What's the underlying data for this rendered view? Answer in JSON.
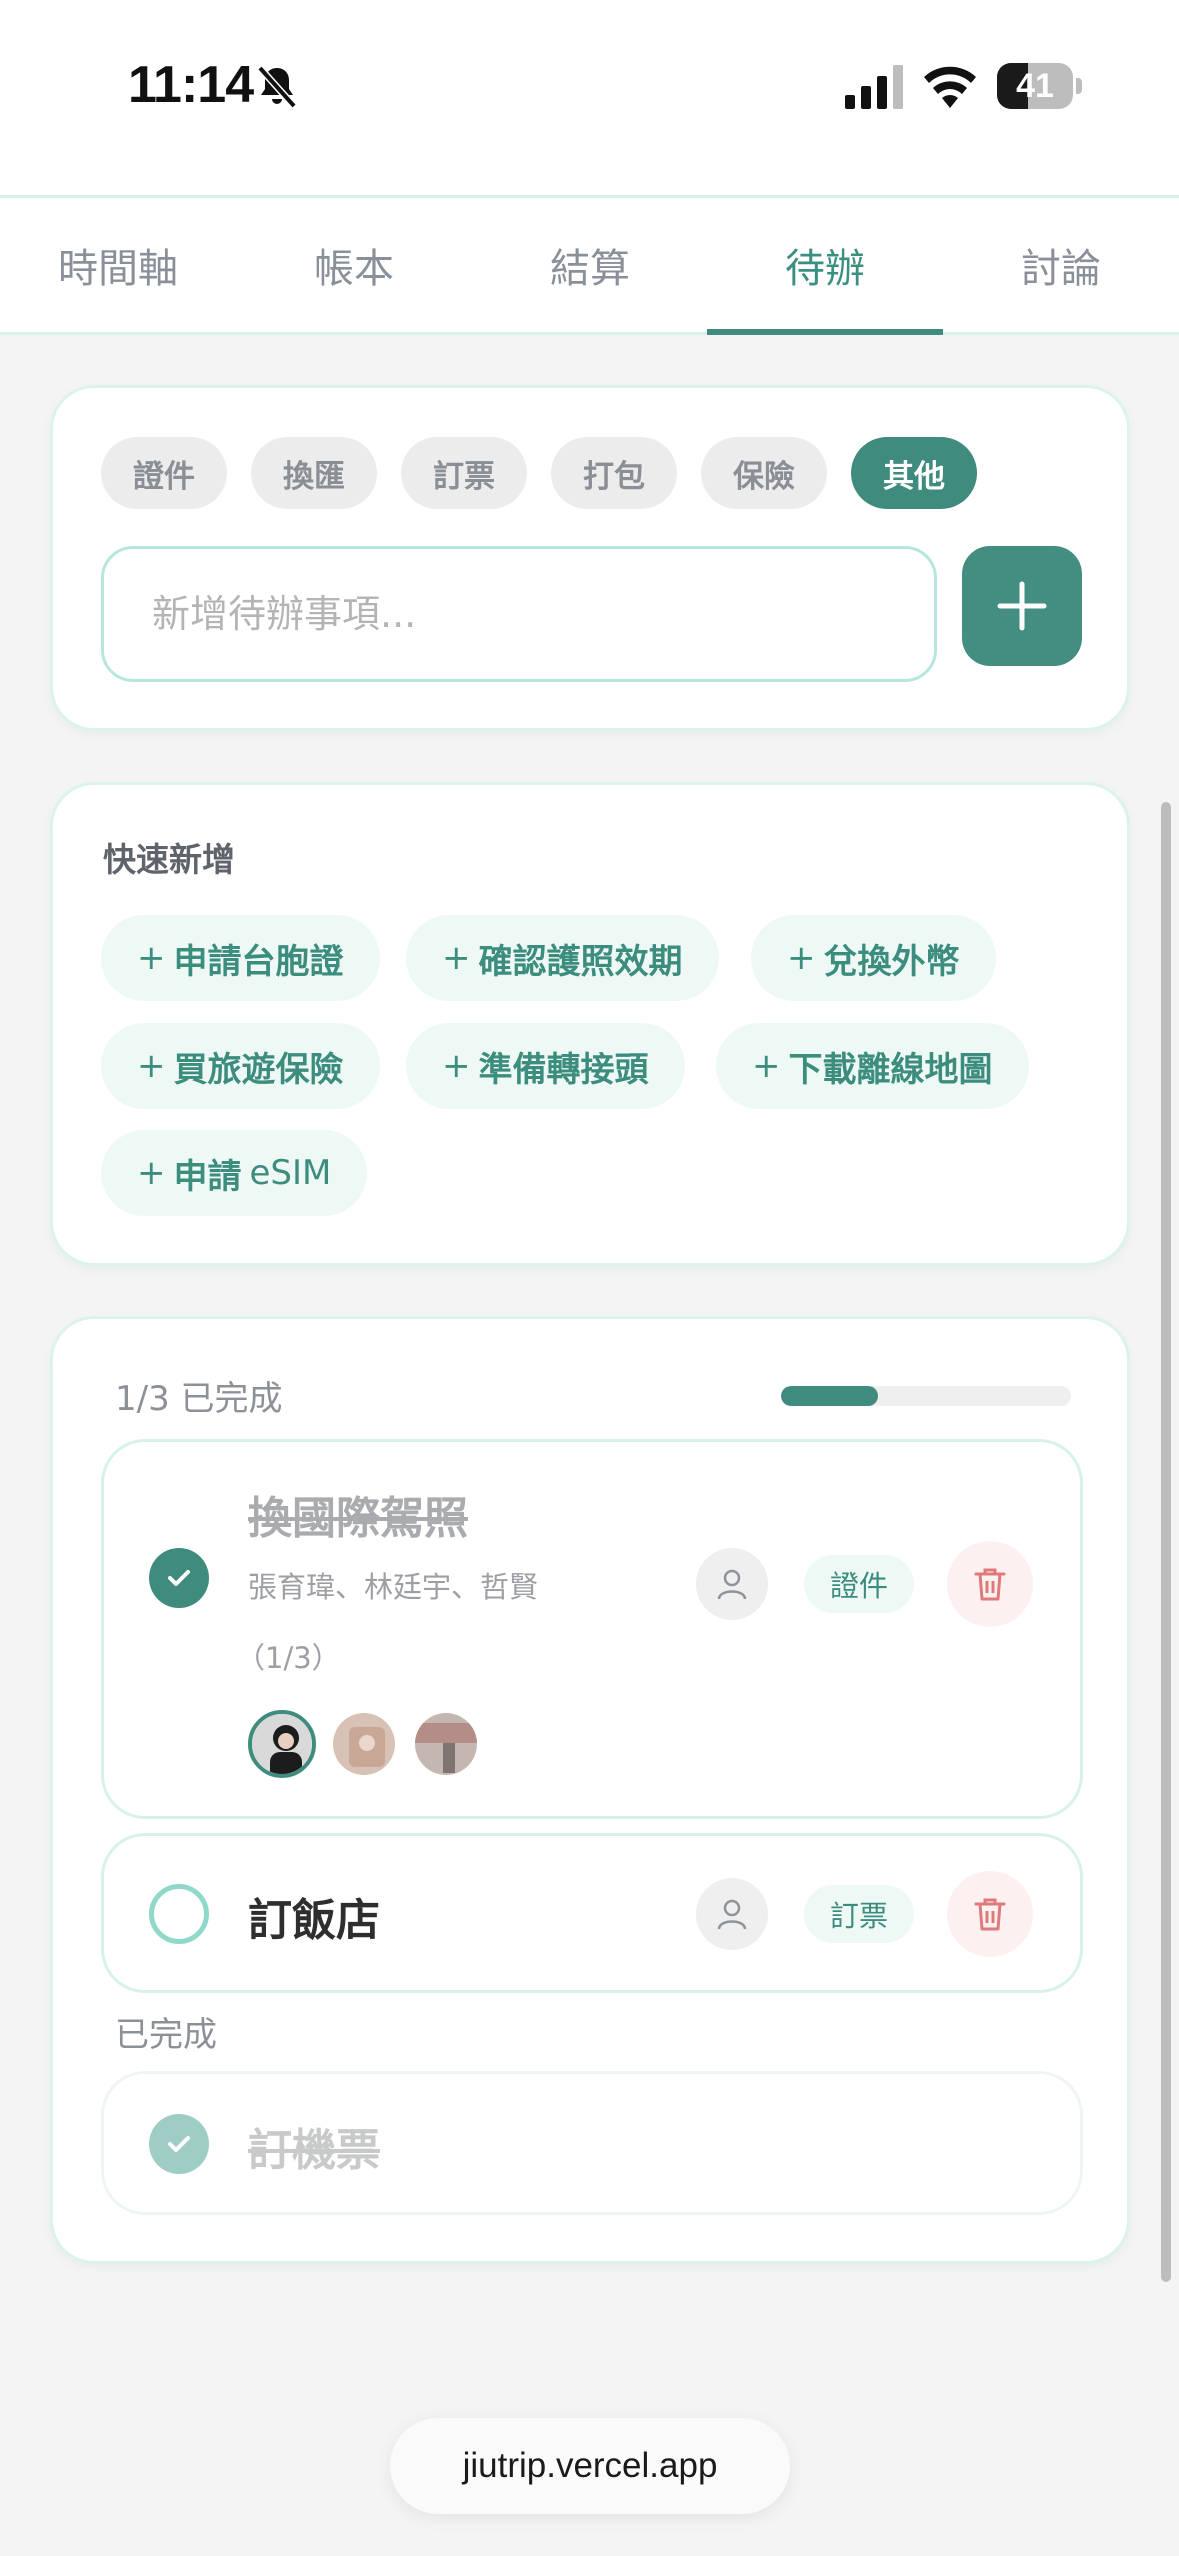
{
  "status_bar": {
    "time": "11:14",
    "battery_level": "41",
    "battery_fraction": 0.41
  },
  "tabs": [
    {
      "label": "時間軸"
    },
    {
      "label": "帳本"
    },
    {
      "label": "結算"
    },
    {
      "label": "待辦",
      "active": true
    },
    {
      "label": "討論"
    }
  ],
  "categories": [
    {
      "label": "證件"
    },
    {
      "label": "換匯"
    },
    {
      "label": "訂票"
    },
    {
      "label": "打包"
    },
    {
      "label": "保險"
    },
    {
      "label": "其他",
      "active": true
    }
  ],
  "new_todo": {
    "placeholder": "新增待辦事項...",
    "value": "",
    "add_icon": "plus-icon"
  },
  "quick_add": {
    "title": "快速新增",
    "prefix": "+",
    "items": [
      {
        "label": "申請台胞證"
      },
      {
        "label": "確認護照效期"
      },
      {
        "label": "兌換外幣"
      },
      {
        "label": "買旅遊保險"
      },
      {
        "label": "準備轉接頭"
      },
      {
        "label": "下載離線地圖"
      },
      {
        "label": "申請",
        "suffix": "eSIM"
      }
    ]
  },
  "progress": {
    "label": "1/3 已完成",
    "fraction": 0.3333
  },
  "todos": [
    {
      "title": "換國際駕照",
      "assignees": "張育瑋、林廷宇、哲賢",
      "count": "（1/3）",
      "tag": "證件",
      "done_partial": true
    },
    {
      "title": "訂飯店",
      "tag": "訂票",
      "done": false
    }
  ],
  "completed_section": {
    "label": "已完成",
    "items": [
      {
        "title": "訂機票",
        "done": true
      }
    ]
  },
  "url_bar": {
    "text": "jiutrip.vercel.app"
  },
  "colors": {
    "accent": "#3f8b7e",
    "accent_light": "#eef9f6",
    "danger": "#e07a7a",
    "border": "#d6f2ea"
  }
}
